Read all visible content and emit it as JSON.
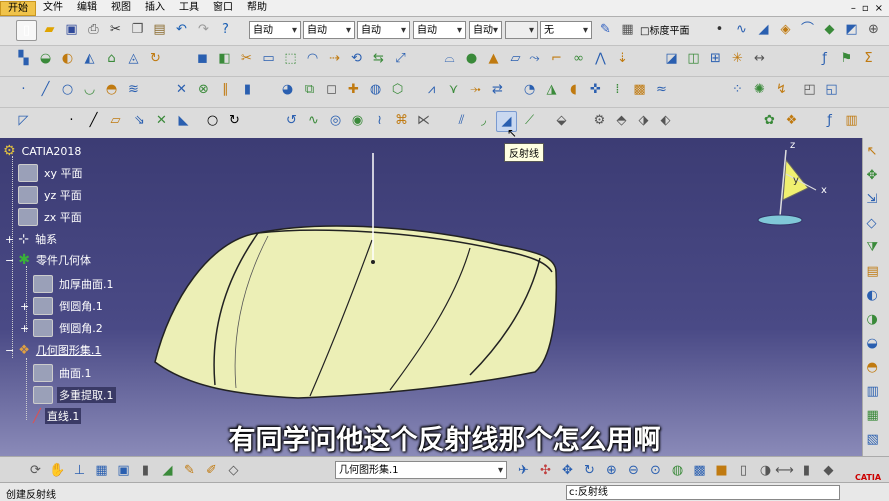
{
  "menubar": {
    "items": [
      {
        "label": "开始",
        "active": true
      },
      {
        "label": "文件"
      },
      {
        "label": "编辑"
      },
      {
        "label": "视图"
      },
      {
        "label": "插入"
      },
      {
        "label": "工具"
      },
      {
        "label": "窗口"
      },
      {
        "label": "帮助"
      }
    ],
    "window_buttons": [
      "–",
      "▫",
      "×"
    ]
  },
  "toolbar_top": {
    "selects": [
      "自动",
      "自动",
      "自动",
      "自动",
      "自动",
      "无"
    ],
    "checkbox_label": "□标度平面"
  },
  "tree": {
    "root": "CATIA2018",
    "xy": "xy 平面",
    "yz": "yz 平面",
    "zx": "zx 平面",
    "axis": "轴系",
    "body": "零件几何体",
    "thick": "加厚曲面.1",
    "fillet1": "倒圆角.1",
    "fillet2": "倒圆角.2",
    "geoset": "几何图形集.1",
    "surface": "曲面.1",
    "extract": "多重提取.1",
    "line": "直线.1"
  },
  "tooltip": "反射线",
  "compass": {
    "x": "x",
    "y": "y",
    "z": "z"
  },
  "subtitle": "有同学问他这个反射线那个怎么用啊",
  "bottom": {
    "geoset_select": "几何图形集.1"
  },
  "status": {
    "left": "创建反射线",
    "command": "c:反射线"
  },
  "logo": "CATIA"
}
